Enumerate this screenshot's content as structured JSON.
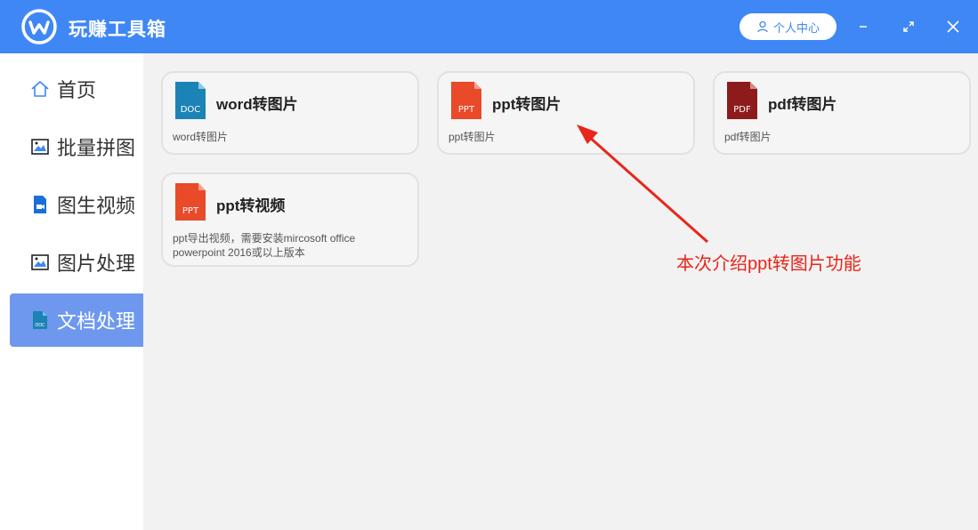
{
  "header": {
    "title": "玩赚工具箱",
    "user_center": "个人中心",
    "logo_icon": "wave-w-logo",
    "controls": [
      "minimize-icon",
      "maximize-icon",
      "close-icon"
    ]
  },
  "sidebar": {
    "items": [
      {
        "label": "首页",
        "icon": "home-icon"
      },
      {
        "label": "批量拼图",
        "icon": "image-icon"
      },
      {
        "label": "图生视频",
        "icon": "video-file-icon"
      },
      {
        "label": "图片处理",
        "icon": "image-icon"
      },
      {
        "label": "文档处理",
        "icon": "doc-file-icon",
        "active": true
      }
    ]
  },
  "cards": [
    {
      "title": "word转图片",
      "desc": "word转图片",
      "badge": "DOC",
      "color": "#1b83b5"
    },
    {
      "title": "ppt转图片",
      "desc": "ppt转图片",
      "badge": "PPT",
      "color": "#e84a2a"
    },
    {
      "title": "pdf转图片",
      "desc": "pdf转图片",
      "badge": "PDF",
      "color": "#8e1b1b"
    },
    {
      "title": "ppt转视频",
      "desc": "ppt导出视频，需要安装mircosoft office powerpoint 2016或以上版本",
      "badge": "PPT",
      "color": "#e84a2a"
    }
  ],
  "annotation": {
    "text": "本次介绍ppt转图片功能",
    "color": "#e8261a"
  },
  "colors": {
    "titlebar": "#3f87f5",
    "sidebar_active": "#6e98ee",
    "background": "#f2f2f2"
  }
}
